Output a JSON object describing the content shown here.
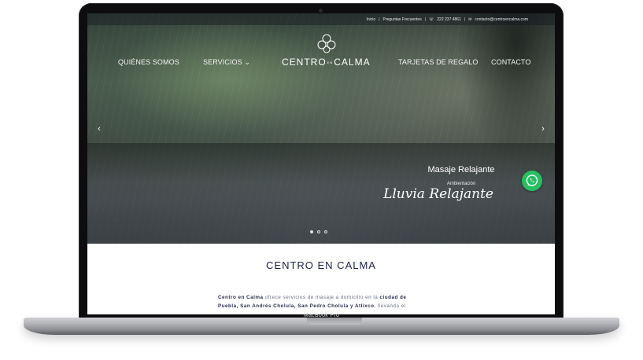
{
  "topbar": {
    "links": [
      "Inicio",
      "Preguntas Frecuentes"
    ],
    "phone": "222 237 4861",
    "email": "contacto@centroencalma.com"
  },
  "nav": {
    "items": [
      "QUIÉNES SOMOS",
      "SERVICIOS",
      "TARJETAS DE REGALO",
      "CONTACTO"
    ],
    "logo_left": "CENTRO",
    "logo_mid": "EN",
    "logo_right": "CALMA"
  },
  "hero": {
    "caption_title": "Masaje Relajante",
    "caption_sub": "Ambientación",
    "caption_script": "Lluvia Relajante",
    "slides": 3,
    "active_slide": 1
  },
  "content": {
    "title": "CENTRO EN CALMA",
    "para_bold1": "Centro en Calma",
    "para_text1": " ofrece servicios de masaje a domicilio en la ",
    "para_bold2": "ciudad de Puebla, San Andrés Cholula, San Pedro Cholula y Atlixco",
    "para_text2": ", llevando el"
  },
  "device": {
    "label": "MacBook Pro"
  },
  "colors": {
    "accent": "#1d2244",
    "whatsapp": "#25c063"
  }
}
